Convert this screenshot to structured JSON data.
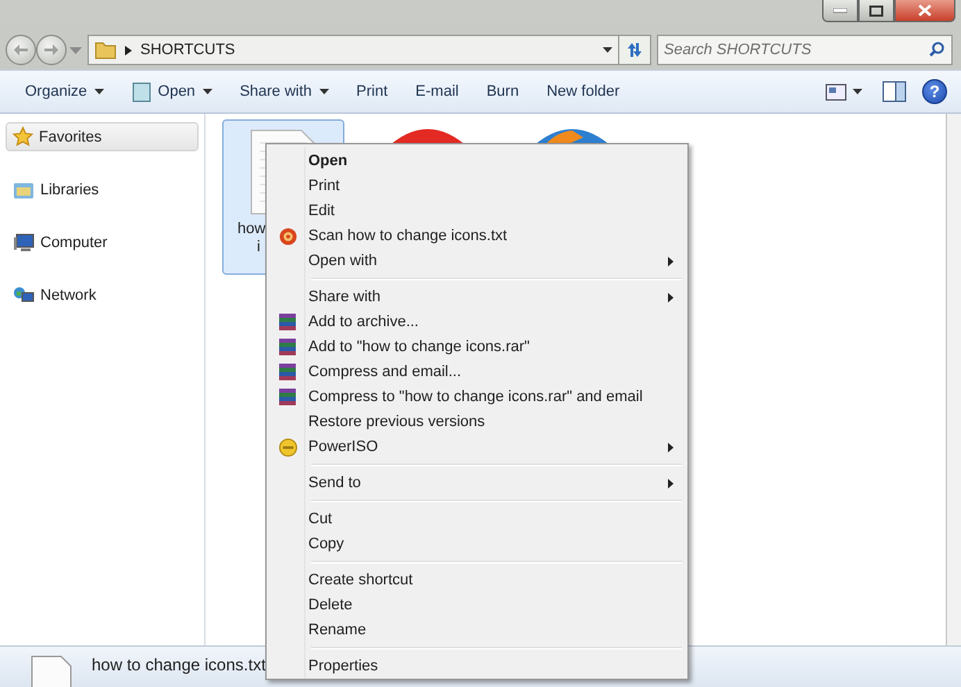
{
  "address": {
    "path": "SHORTCUTS",
    "search_placeholder": "Search SHORTCUTS"
  },
  "toolbar": [
    {
      "label": "Organize",
      "dropdown": true
    },
    {
      "label": "Open",
      "dropdown": true
    },
    {
      "label": "Share with",
      "dropdown": true
    },
    {
      "label": "Print",
      "dropdown": false
    },
    {
      "label": "E-mail",
      "dropdown": false
    },
    {
      "label": "Burn",
      "dropdown": false
    },
    {
      "label": "New folder",
      "dropdown": false
    }
  ],
  "help_button": "?",
  "sidebar": {
    "items": [
      {
        "label": "Favorites",
        "kind": "star",
        "selected": true
      },
      {
        "label": "Libraries",
        "kind": "library",
        "selected": false
      },
      {
        "label": "Computer",
        "kind": "computer",
        "selected": false
      },
      {
        "label": "Network",
        "kind": "network",
        "selected": false
      }
    ]
  },
  "files": [
    {
      "kind": "text",
      "selected": true,
      "label_lines": [
        "how",
        "i"
      ]
    },
    {
      "kind": "red",
      "selected": false
    },
    {
      "kind": "globe",
      "selected": false
    }
  ],
  "context_menu": {
    "groups": [
      [
        {
          "label": "Open",
          "bold": true,
          "kind": "plain",
          "submenu": false
        },
        {
          "label": "Print",
          "bold": false,
          "kind": "plain",
          "submenu": false
        },
        {
          "label": "Edit",
          "bold": false,
          "kind": "plain",
          "submenu": false
        },
        {
          "label": "Scan how to change icons.txt",
          "bold": false,
          "kind": "scan",
          "submenu": false
        },
        {
          "label": "Open with",
          "bold": false,
          "kind": "plain",
          "submenu": true
        }
      ],
      [
        {
          "label": "Share with",
          "bold": false,
          "kind": "plain",
          "submenu": true
        },
        {
          "label": "Add to archive...",
          "bold": false,
          "kind": "archive",
          "submenu": false
        },
        {
          "label": "Add to \"how to change icons.rar\"",
          "bold": false,
          "kind": "archive",
          "submenu": false
        },
        {
          "label": "Compress and email...",
          "bold": false,
          "kind": "archive",
          "submenu": false
        },
        {
          "label": "Compress to \"how to change icons.rar\" and email",
          "bold": false,
          "kind": "archive",
          "submenu": false
        },
        {
          "label": "Restore previous versions",
          "bold": false,
          "kind": "plain",
          "submenu": false
        },
        {
          "label": "PowerISO",
          "bold": false,
          "kind": "disc",
          "submenu": true
        }
      ],
      [
        {
          "label": "Send to",
          "bold": false,
          "kind": "plain",
          "submenu": true
        }
      ],
      [
        {
          "label": "Cut",
          "bold": false,
          "kind": "plain",
          "submenu": false
        },
        {
          "label": "Copy",
          "bold": false,
          "kind": "plain",
          "submenu": false
        }
      ],
      [
        {
          "label": "Create shortcut",
          "bold": false,
          "kind": "plain",
          "submenu": false
        },
        {
          "label": "Delete",
          "bold": false,
          "kind": "plain",
          "submenu": false
        },
        {
          "label": "Rename",
          "bold": false,
          "kind": "plain",
          "submenu": false
        }
      ],
      [
        {
          "label": "Properties",
          "bold": false,
          "kind": "plain",
          "submenu": false
        }
      ]
    ]
  },
  "details": {
    "file_name": "how to change icons.txt"
  }
}
